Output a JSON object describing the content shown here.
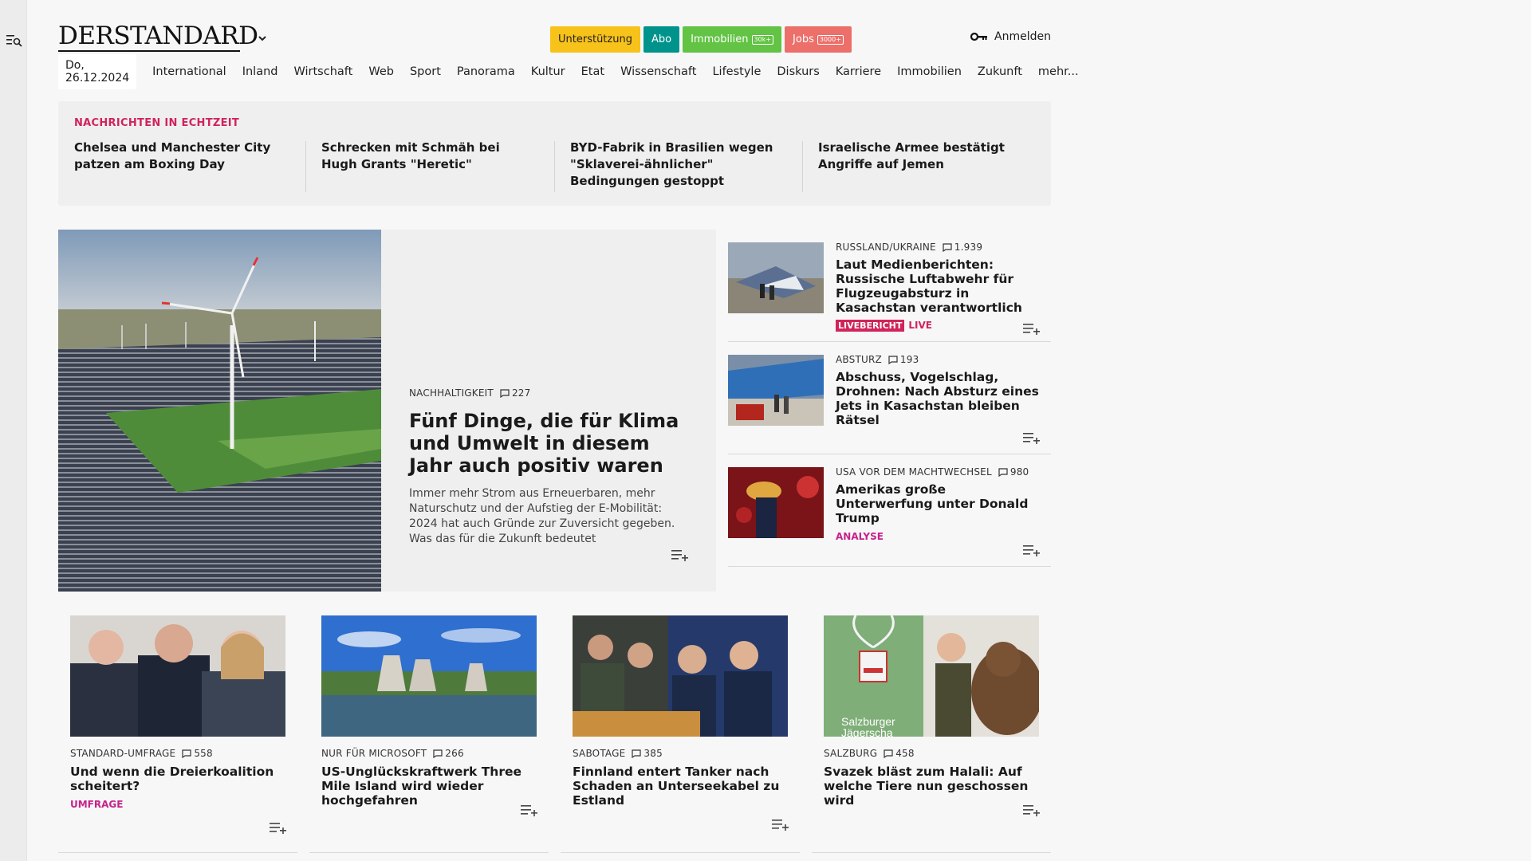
{
  "header": {
    "logo": "DERSTANDARD",
    "pills": [
      {
        "label": "Unterstützung",
        "bg": "#f7c21a",
        "fg": "#222",
        "badge": ""
      },
      {
        "label": "Abo",
        "bg": "#00938c",
        "fg": "#fff",
        "badge": ""
      },
      {
        "label": "Immobilien",
        "bg": "#62c344",
        "fg": "#fff",
        "badge": "30k+"
      },
      {
        "label": "Jobs",
        "bg": "#ec6f6a",
        "fg": "#fff",
        "badge": "3000+"
      }
    ],
    "login_label": "Anmelden"
  },
  "nav": {
    "date": "Do, 26.12.2024",
    "items": [
      "International",
      "Inland",
      "Wirtschaft",
      "Web",
      "Sport",
      "Panorama",
      "Kultur",
      "Etat",
      "Wissenschaft",
      "Lifestyle",
      "Diskurs",
      "Karriere",
      "Immobilien",
      "Zukunft",
      "mehr..."
    ]
  },
  "ticker": {
    "label": "NACHRICHTEN IN ECHTZEIT",
    "items": [
      "Chelsea und Manchester City patzen am Boxing Day",
      "Schrecken mit Schmäh bei Hugh Grants \"Heretic\"",
      "BYD-Fabrik in Brasilien wegen \"Skla­verei-ähnlicher\" Bedingungen gestoppt",
      "Israelische Armee bestätigt Angriffe auf Jemen"
    ]
  },
  "hero": {
    "kicker": "NACHHALTIGKEIT",
    "comments": "227",
    "title": "Fünf Dinge, die für Klima und Umwelt in diesem Jahr auch positiv waren",
    "teaser": "Immer mehr Strom aus Erneuerbaren, mehr Naturschutz und der Aufstieg der E-Mobilität: 2024 hat auch Gründe zur Zuversicht gegeben. Was das für die Zukunft bedeutet"
  },
  "side": [
    {
      "kicker": "RUSSLAND/UKRAINE",
      "comments": "1.939",
      "title": "Laut Medienberichten: Russische Luftabwehr für Flugzeugabsturz in Kasachstan verantwortlich",
      "tag": "LIVEBERICHT",
      "tag2": "LIVE"
    },
    {
      "kicker": "ABSTURZ",
      "comments": "193",
      "title": "Abschuss, Vogelschlag, Drohnen: Nach Absturz eines Jets in Kasachstan bleiben Rätsel"
    },
    {
      "kicker": "USA VOR DEM MACHTWECHSEL",
      "comments": "980",
      "title": "Amerikas große Unterwerfung unter Donald Trump",
      "tag": "ANALYSE"
    }
  ],
  "cards": [
    {
      "kicker": "STANDARD-UMFRAGE",
      "comments": "558",
      "title": "Und wenn die Dreierkoalition scheitert?",
      "tag": "UMFRAGE"
    },
    {
      "kicker": "NUR FÜR MICROSOFT",
      "comments": "266",
      "title": "US-Unglückskraftwerk Three Mile Island wird wieder hochgefahren"
    },
    {
      "kicker": "SABOTAGE",
      "comments": "385",
      "title": "Finnland entert Tanker nach Schaden an Unterseekabel zu Estland"
    },
    {
      "kicker": "SALZBURG",
      "comments": "458",
      "title": "Svazek bläst zum Halali: Auf welche Tiere nun geschossen wird",
      "img_text": "Salzburger Jägerschaft"
    }
  ],
  "colors": {
    "accent": "#d0245a",
    "magenta": "#c6228c"
  }
}
